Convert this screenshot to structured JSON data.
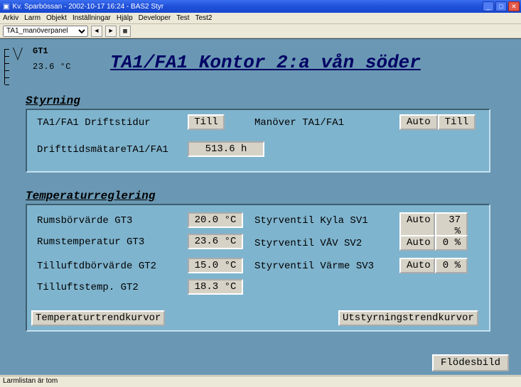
{
  "window": {
    "title": "Kv. Sparbössan  -  2002-10-17 16:24  -  BAS2 Styr"
  },
  "menu": [
    "Arkiv",
    "Larm",
    "Objekt",
    "Inställningar",
    "Hjälp",
    "Developer",
    "Test",
    "Test2"
  ],
  "toolbar": {
    "dropdown": "TA1_manöverpanel"
  },
  "gauge": {
    "name": "GT1",
    "value": "23.6 °C"
  },
  "page_title": "TA1/FA1 Kontor 2:a vån söder",
  "styrning": {
    "title": "Styrning",
    "driftstidur_label": "TA1/FA1 Driftstidur",
    "driftstidur_btn": "Till",
    "manover_label": "Manöver TA1/FA1",
    "manover_auto": "Auto",
    "manover_till": "Till",
    "meter_label": "DrifttidsmätareTA1/FA1",
    "meter_value": "513.6 h"
  },
  "tempreg": {
    "title": "Temperaturreglering",
    "rows_left": [
      {
        "label": "Rumsbörvärde GT3",
        "value": "20.0 °C"
      },
      {
        "label": "Rumstemperatur GT3",
        "value": "23.6 °C"
      },
      {
        "label": "Tilluftdbörvärde GT2",
        "value": "15.0 °C"
      },
      {
        "label": "Tilluftstemp. GT2",
        "value": "18.3 °C"
      }
    ],
    "rows_right": [
      {
        "label": "Styrventil Kyla SV1",
        "mode": "Auto",
        "pct": "37 %"
      },
      {
        "label": "Styrventil VÅV SV2",
        "mode": "Auto",
        "pct": "0 %"
      },
      {
        "label": "Styrventil Värme SV3",
        "mode": "Auto",
        "pct": "0 %"
      }
    ],
    "trend_left_btn": "Temperaturtrendkurvor",
    "trend_right_btn": "Utstyrningstrendkurvor"
  },
  "footer_btn": "Flödesbild",
  "statusbar": "Larmlistan är tom"
}
